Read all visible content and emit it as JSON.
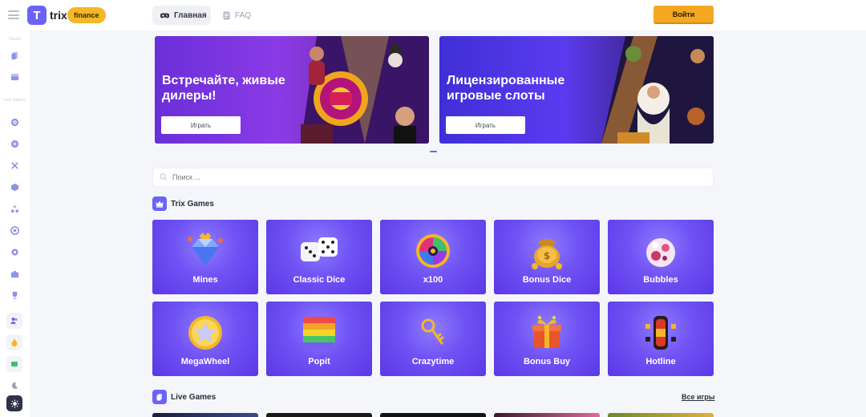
{
  "header": {
    "logo_letter": "T",
    "brand": "trix",
    "badge": "finance",
    "nav": [
      {
        "label": "Главная",
        "icon": "gamepad-icon"
      },
      {
        "label": "FAQ",
        "icon": "document-icon"
      }
    ],
    "login": "Войти"
  },
  "sidebar": {
    "labels": [
      "Casino",
      "Live Games"
    ],
    "icons": [
      "copy-icon",
      "chest-icon",
      "target-icon",
      "chip-icon",
      "crossed-swords-icon",
      "box-icon",
      "molecule-icon",
      "coin-icon",
      "gear-icon",
      "puzzle-icon",
      "trophy-icon",
      "users-icon",
      "fire-icon",
      "ticket-icon",
      "moon-icon",
      "sun-icon"
    ]
  },
  "banners": [
    {
      "title": "Встречайте, живые дилеры!",
      "button": "Играть"
    },
    {
      "title": "Лицензированные игровые слоты",
      "button": "Играть"
    }
  ],
  "search": {
    "placeholder": "Поиск ..."
  },
  "sections": {
    "trix_games": "Trix Games",
    "live_games": "Live Games",
    "all_games": "Все игры"
  },
  "games": [
    {
      "name": "Mines",
      "icon": "diamond-icon"
    },
    {
      "name": "Classic Dice",
      "icon": "dice-icon"
    },
    {
      "name": "x100",
      "icon": "wheel-icon"
    },
    {
      "name": "Bonus Dice",
      "icon": "money-bag-icon"
    },
    {
      "name": "Bubbles",
      "icon": "bubble-icon"
    },
    {
      "name": "MegaWheel",
      "icon": "star-coin-icon"
    },
    {
      "name": "Popit",
      "icon": "popit-icon"
    },
    {
      "name": "Crazytime",
      "icon": "key-icon"
    },
    {
      "name": "Bonus Buy",
      "icon": "gift-icon"
    },
    {
      "name": "Hotline",
      "icon": "slot-reel-icon"
    }
  ],
  "colors": {
    "accent": "#6b63f6",
    "login": "#f4a822",
    "badge": "#f4b728"
  }
}
